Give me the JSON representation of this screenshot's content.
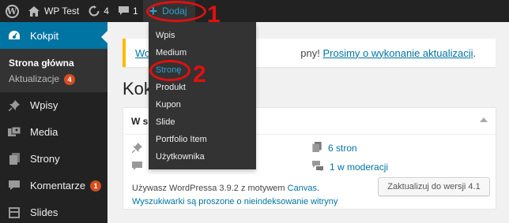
{
  "adminbar": {
    "site_name": "WP Test",
    "updates_count": "4",
    "comments_count": "1",
    "new_label": "Dodaj"
  },
  "sidebar": {
    "dashboard_label": "Kokpit",
    "home_label": "Strona główna",
    "updates_label": "Aktualizacje",
    "updates_badge": "4",
    "items": [
      {
        "label": "Wpisy",
        "icon": "pushpin-icon"
      },
      {
        "label": "Media",
        "icon": "media-icon"
      },
      {
        "label": "Strony",
        "icon": "pages-icon"
      },
      {
        "label": "Komentarze",
        "icon": "comments-icon",
        "badge": "1"
      },
      {
        "label": "Slides",
        "icon": "slides-icon"
      }
    ]
  },
  "notice": {
    "prefix": "Wo",
    "middle": "pny!",
    "link": "Prosimy o wykonanie aktualizacji",
    "suffix": "."
  },
  "page": {
    "title": "Kok"
  },
  "glance": {
    "header": "W s",
    "pages": "6 stron",
    "moderation": "1 w moderacji",
    "version_text": "Używasz WordPressa 3.9.2 z motywem",
    "theme_link": "Canvas",
    "search_notice": "Wyszukiwarki są proszone o nieindeksowanie witryny",
    "upgrade_button": "Zaktualizuj do wersji 4.1"
  },
  "dropdown": {
    "items": [
      "Wpis",
      "Medium",
      "Stronę",
      "Produkt",
      "Kupon",
      "Slide",
      "Portfolio Item",
      "Użytkownika"
    ]
  },
  "annotations": {
    "num1": "1",
    "num2": "2",
    "color": "#e01010"
  },
  "colors": {
    "adminbar_bg": "#222222",
    "accent": "#0074a2",
    "highlight": "#2ea2cc",
    "notice_border": "#ffba00",
    "badge": "#d54e21"
  }
}
